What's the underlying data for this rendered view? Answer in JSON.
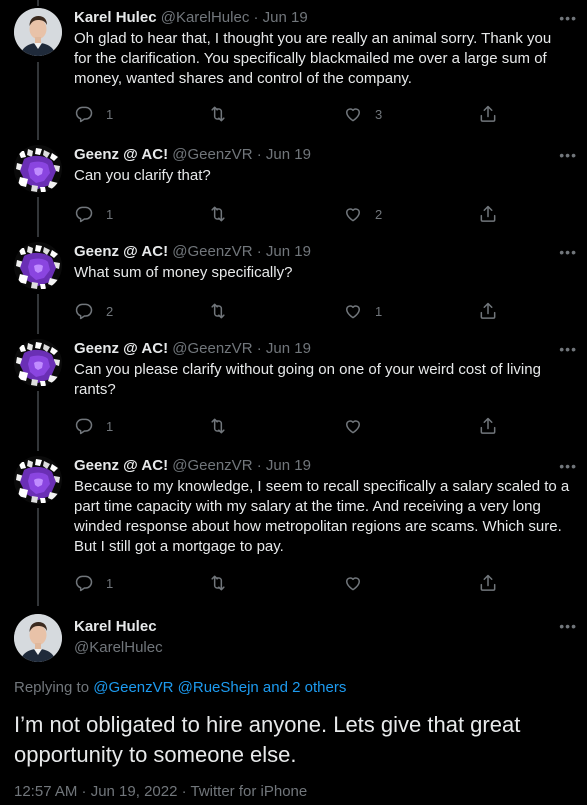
{
  "tweets": [
    {
      "name": "Karel Hulec",
      "handle": "@KarelHulec",
      "date": "Jun 19",
      "text": "Oh glad to hear that, I thought you are really an animal sorry. Thank you for the clarification. You specifically blackmailed me over a large sum of money, wanted shares and control of the company.",
      "replies": "1",
      "retweets": "",
      "likes": "3",
      "avatar": "karel"
    },
    {
      "name": "Geenz @ AC!",
      "handle": "@GeenzVR",
      "date": "Jun 19",
      "text": "Can you clarify that?",
      "replies": "1",
      "retweets": "",
      "likes": "2",
      "avatar": "geenz"
    },
    {
      "name": "Geenz @ AC!",
      "handle": "@GeenzVR",
      "date": "Jun 19",
      "text": "What sum of money specifically?",
      "replies": "2",
      "retweets": "",
      "likes": "1",
      "avatar": "geenz"
    },
    {
      "name": "Geenz @ AC!",
      "handle": "@GeenzVR",
      "date": "Jun 19",
      "text": "Can you please clarify without going on one of your weird cost of living rants?",
      "replies": "1",
      "retweets": "",
      "likes": "",
      "avatar": "geenz"
    },
    {
      "name": "Geenz @ AC!",
      "handle": "@GeenzVR",
      "date": "Jun 19",
      "text": "Because to my knowledge, I seem to recall specifically a salary scaled to a part time capacity with my salary at the time.  And receiving a very long winded response about how metropolitan regions are scams.  Which sure. But I still got a mortgage to pay.",
      "replies": "1",
      "retweets": "",
      "likes": "",
      "avatar": "geenz"
    }
  ],
  "main_tweet": {
    "name": "Karel Hulec",
    "handle": "@KarelHulec",
    "replying_prefix": "Replying to ",
    "replying_to": "@GeenzVR @RueShejn and 2 others",
    "text": "I’m not obligated to hire anyone. Lets give that great opportunity to someone else.",
    "meta": "12:57 AM · Jun 19, 2022 · Twitter for iPhone"
  },
  "ui": {
    "dot": "·",
    "more": "•••"
  },
  "colors": {
    "background": "#000000",
    "text": "#e7e9ea",
    "secondary": "#71767b",
    "link": "#1d9bf0",
    "thread_line": "#333639"
  }
}
